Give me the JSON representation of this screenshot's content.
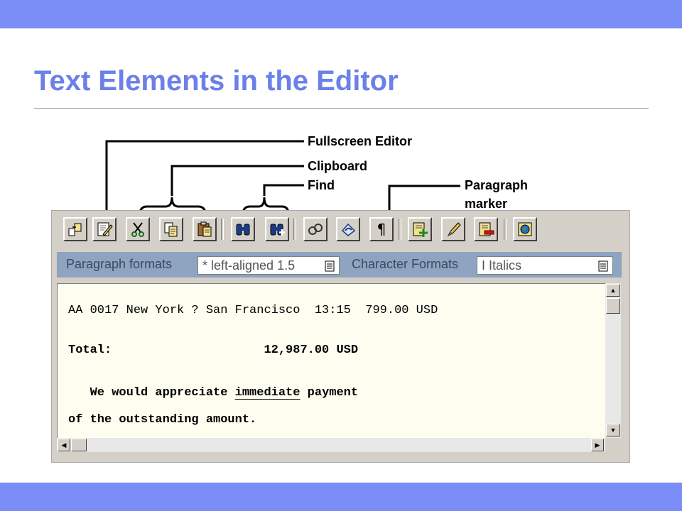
{
  "slide": {
    "title": "Text Elements in the Editor"
  },
  "callouts": {
    "fullscreen": "Fullscreen Editor",
    "clipboard": "Clipboard",
    "find": "Find",
    "paragraph_line1": "Paragraph",
    "paragraph_line2": "marker"
  },
  "toolbar": {
    "groups": [
      [
        "change-mode-icon",
        "fullscreen-editor-icon",
        "cut-icon",
        "copy-icon",
        "paste-icon"
      ],
      [
        "find-icon",
        "find-next-icon"
      ],
      [
        "check-icon",
        "undo-icon",
        "paragraph-marker-icon"
      ],
      [
        "insert-command-icon",
        "edit-pencil-icon",
        "delete-line-icon"
      ],
      [
        "graphics-icon"
      ]
    ]
  },
  "format_bar": {
    "paragraph_label": "Paragraph formats",
    "paragraph_value": "* left-aligned 1.5",
    "character_label": "Character Formats",
    "character_value": "I Italics"
  },
  "editor": {
    "lines": [
      "AA 0017 New York ? San Francisco  13:15  799.00 USD",
      "Total:                     12,987.00 USD",
      "   We would appreciate ",
      "immediate",
      " payment",
      "of the outstanding amount."
    ]
  },
  "colors": {
    "accent": "#7b8ef7",
    "title": "#6b80e8",
    "format_bar": "#8ea4c0",
    "editor_bg": "#fdfdf0",
    "frame_bg": "#d4d0c8"
  }
}
